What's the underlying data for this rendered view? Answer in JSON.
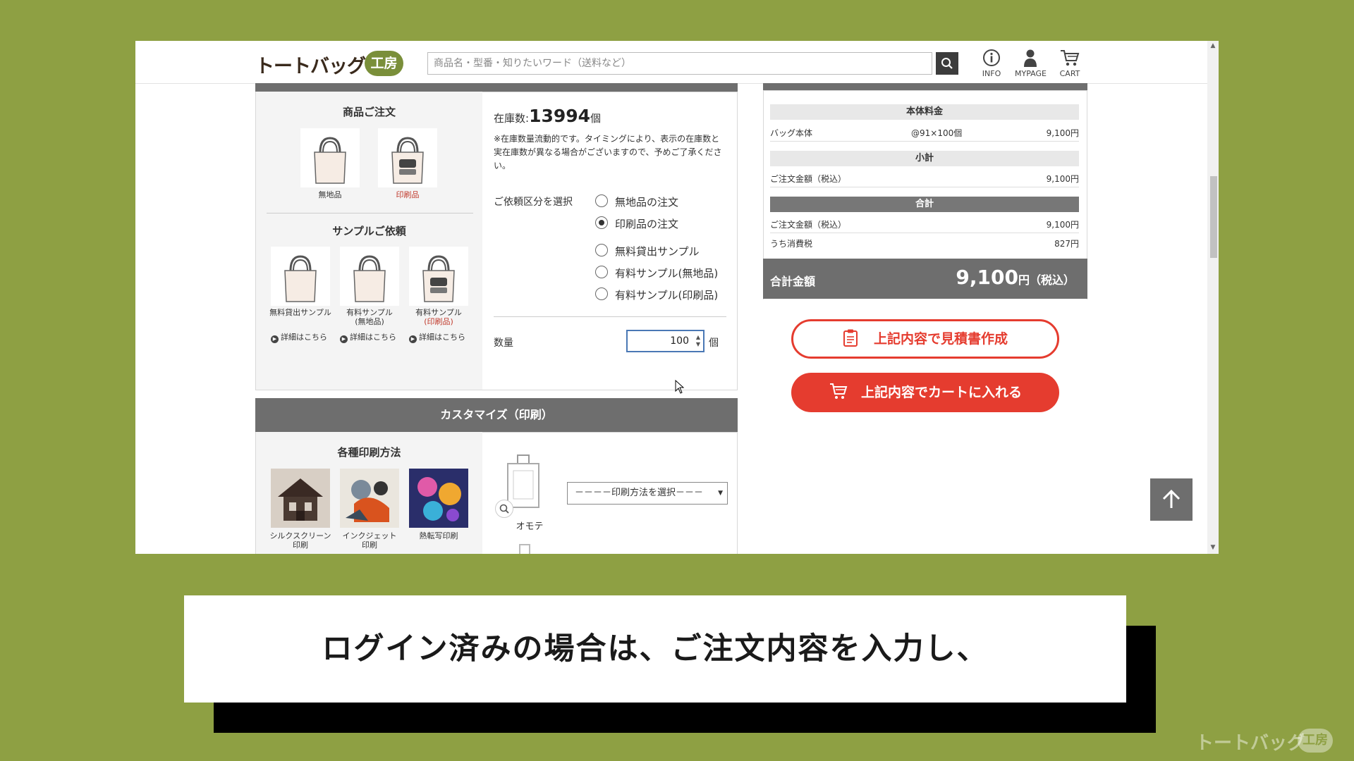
{
  "header": {
    "logo_text": "トートバッグ",
    "logo_badge": "工房",
    "search_placeholder": "商品名・型番・知りたいワード（送料など）",
    "info_label": "INFO",
    "mypage_label": "MYPAGE",
    "cart_label": "CART"
  },
  "order": {
    "section_title": "商品ご注文",
    "items": [
      {
        "caption": "無地品"
      },
      {
        "caption": "印刷品"
      }
    ],
    "stock_label": "在庫数:",
    "stock_value": "13994",
    "stock_unit": "個",
    "stock_note": "※在庫数量流動的です。タイミングにより、表示の在庫数と実在庫数が異なる場合がございますので、予めご了承ください。",
    "request_type_label": "ご依頼区分を選択",
    "options": [
      {
        "label": "無地品の注文",
        "selected": false
      },
      {
        "label": "印刷品の注文",
        "selected": true
      },
      {
        "label": "無料貸出サンプル",
        "selected": false
      },
      {
        "label": "有料サンプル(無地品)",
        "selected": false
      },
      {
        "label": "有料サンプル(印刷品)",
        "selected": false
      }
    ],
    "quantity_label": "数量",
    "quantity_value": "100",
    "quantity_unit": "個"
  },
  "sample": {
    "section_title": "サンプルご依頼",
    "items": [
      {
        "caption": "無料貸出サンプル",
        "sub": ""
      },
      {
        "caption": "有料サンプル",
        "sub": "(無地品)"
      },
      {
        "caption": "有料サンプル",
        "sub": "(印刷品)"
      }
    ],
    "detail_link": "詳細はこちら"
  },
  "customize": {
    "title": "カスタマイズ（印刷）",
    "methods_title": "各種印刷方法",
    "methods": [
      {
        "line1": "シルクスクリーン",
        "line2": "印刷"
      },
      {
        "line1": "インクジェット",
        "line2": "印刷"
      },
      {
        "line1": "熱転写印刷",
        "line2": ""
      }
    ],
    "side_label": "オモテ",
    "print_select": "－－－－印刷方法を選択－－－"
  },
  "summary": {
    "base_title": "本体料金",
    "bag_label": "バッグ本体",
    "bag_unit": "@91×100個",
    "bag_price": "9,100円",
    "subtotal_title": "小計",
    "subtotal_label": "ご注文金額（税込）",
    "subtotal_price": "9,100円",
    "total_title": "合計",
    "total_label": "ご注文金額（税込）",
    "total_price": "9,100円",
    "tax_label": "うち消費税",
    "tax_price": "827円",
    "grand_label": "合計金額",
    "grand_value": "9,100",
    "grand_suffix": "円（税込）",
    "estimate_button": "上記内容で見積書作成",
    "cart_button": "上記内容でカートに入れる"
  },
  "caption": {
    "text": "ログイン済みの場合は、ご注文内容を入力し、"
  },
  "watermark": {
    "text": "トートバッグ",
    "badge": "工房"
  },
  "colors": {
    "background": "#8ea043",
    "accent_red": "#e53c2f",
    "dark_bar": "#6e6e6e"
  }
}
